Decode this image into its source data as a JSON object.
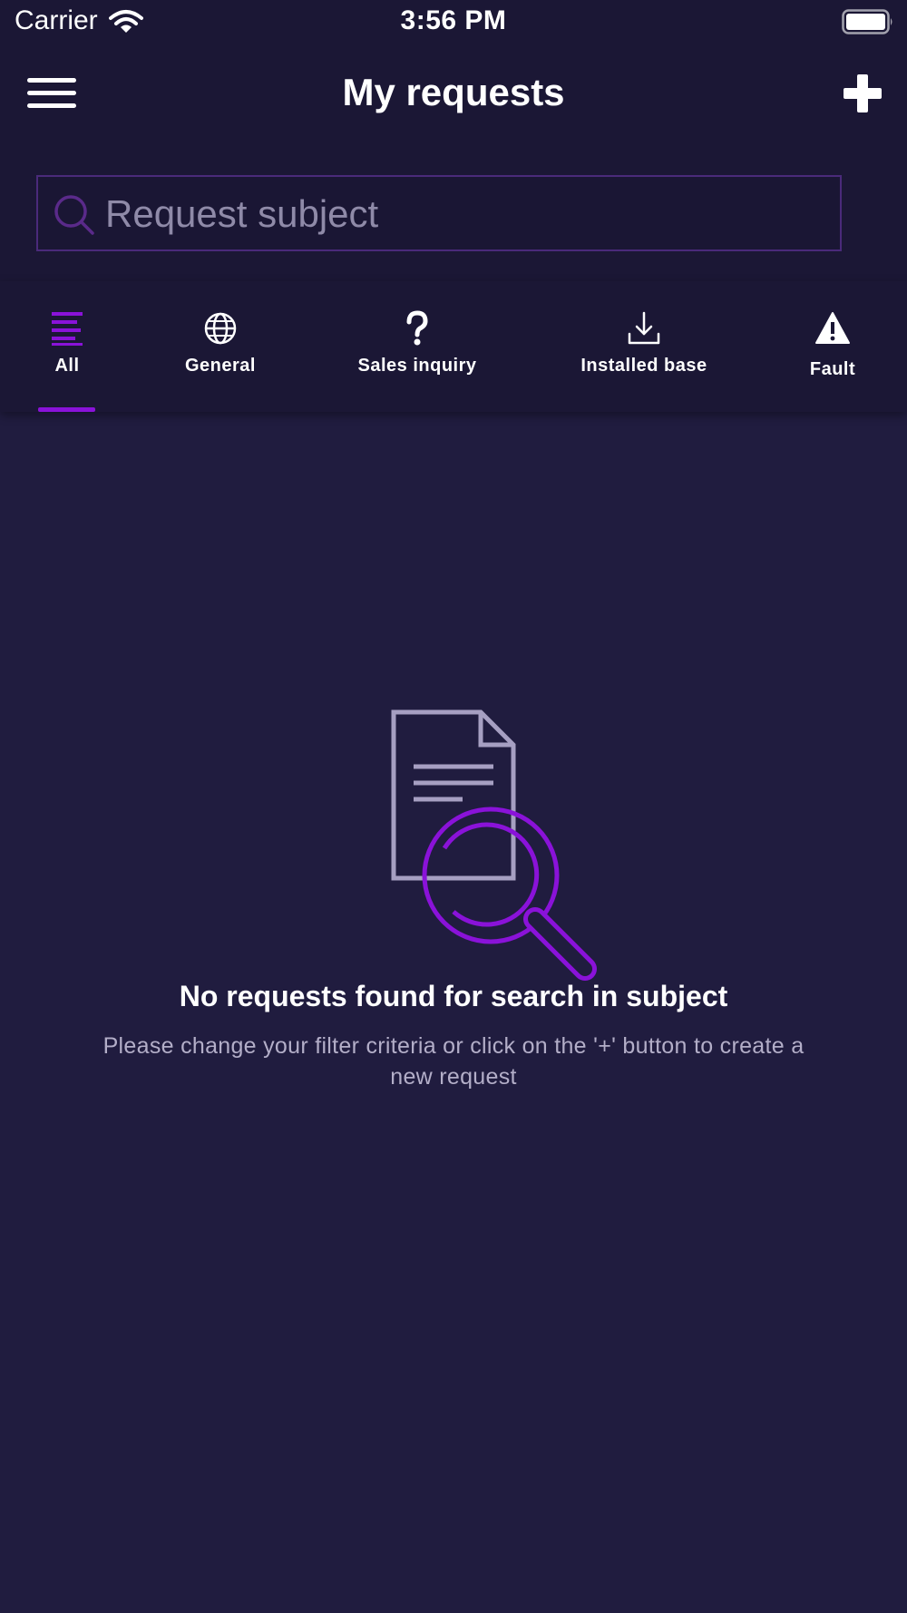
{
  "status_bar": {
    "carrier": "Carrier",
    "time": "3:56 PM"
  },
  "nav": {
    "title": "My requests",
    "menu_icon": "hamburger-menu-icon",
    "add_icon": "plus-icon"
  },
  "search": {
    "placeholder": "Request subject",
    "value": "",
    "icon": "search-icon"
  },
  "tabs": [
    {
      "label": "All",
      "icon": "list-lines-icon",
      "selected": true
    },
    {
      "label": "General",
      "icon": "globe-icon",
      "selected": false
    },
    {
      "label": "Sales inquiry",
      "icon": "question-mark-icon",
      "selected": false
    },
    {
      "label": "Installed base",
      "icon": "download-icon",
      "selected": false
    },
    {
      "label": "Fault",
      "icon": "warning-triangle-icon",
      "selected": false
    }
  ],
  "empty_state": {
    "icon": "document-search-icon",
    "title": "No requests found for search in subject",
    "message": "Please change your filter criteria or click on the '+' button to create a new request"
  },
  "colors": {
    "background": "#201c3f",
    "header_background": "#1b1735",
    "accent": "#8a12d9",
    "muted_text": "#b3aec8"
  }
}
